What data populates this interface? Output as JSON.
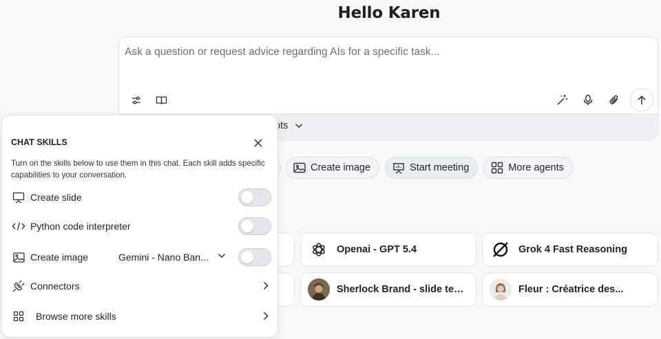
{
  "greeting": "Hello Karen",
  "composer": {
    "placeholder": "Ask a question or request advice regarding AIs for a specific task...",
    "prompts_label": "pts",
    "icons_left": [
      "sliders-icon",
      "book-open-icon"
    ],
    "icons_right": [
      "magic-wand-icon",
      "microphone-icon",
      "paperclip-icon",
      "arrow-up-icon"
    ]
  },
  "chips": [
    {
      "label": "Create image",
      "icon": "image-icon"
    },
    {
      "label": "Start meeting",
      "icon": "presentation-icon"
    },
    {
      "label": "More agents",
      "icon": "grid-icon"
    }
  ],
  "agents": [
    {
      "name": "Openai - GPT 5.4",
      "icon": "openai-logo-icon"
    },
    {
      "name": "Grok 4 Fast Reasoning",
      "icon": "grok-logo-icon"
    },
    {
      "name": "Sherlock Brand - slide templa...",
      "icon": "sherlock-avatar"
    },
    {
      "name": "Fleur : Créatrice des...",
      "icon": "fleur-avatar"
    }
  ],
  "skills_panel": {
    "title": "CHAT SKILLS",
    "description": "Turn on the skills below to use them in this chat. Each skill adds specific capabilities to your conversation.",
    "skills": [
      {
        "label": "Create slide",
        "icon": "presentation-icon",
        "enabled": false
      },
      {
        "label": "Python code interpreter",
        "icon": "code-icon",
        "enabled": false
      },
      {
        "label": "Create image",
        "icon": "image-icon",
        "model": "Gemini - Nano Ban...",
        "enabled": false
      },
      {
        "label": "Connectors",
        "icon": "plug-icon"
      },
      {
        "label": "Browse more skills",
        "icon": "grid-icon"
      }
    ]
  }
}
